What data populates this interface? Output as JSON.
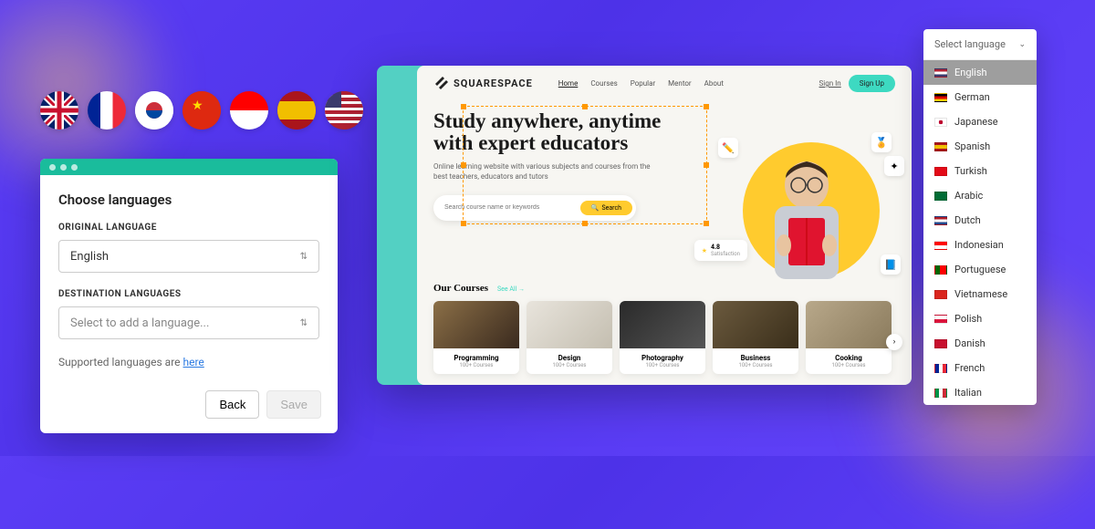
{
  "modal": {
    "title": "Choose languages",
    "original_label": "ORIGINAL LANGUAGE",
    "original_value": "English",
    "destination_label": "DESTINATION LANGUAGES",
    "destination_placeholder": "Select to add a language...",
    "supported_prefix": "Supported languages are ",
    "supported_link": "here",
    "back": "Back",
    "save": "Save"
  },
  "site": {
    "brand": "SQUARESPACE",
    "nav": {
      "home": "Home",
      "courses": "Courses",
      "popular": "Popular",
      "mentor": "Mentor",
      "about": "About"
    },
    "signin": "Sign In",
    "signup": "Sign Up",
    "hero_title": "Study anywhere, anytime with expert educators",
    "hero_sub": "Online learning website with various subjects and courses from the best teachers, educators and tutors",
    "search_placeholder": "Search course name or keywords",
    "search_btn": "Search",
    "rating_score": "4.8",
    "rating_label": "Satisfaction",
    "courses_title": "Our Courses",
    "see_all": "See All",
    "courses": [
      {
        "name": "Programming",
        "count": "100+ Courses"
      },
      {
        "name": "Design",
        "count": "100+ Courses"
      },
      {
        "name": "Photography",
        "count": "100+ Courses"
      },
      {
        "name": "Business",
        "count": "100+ Courses"
      },
      {
        "name": "Cooking",
        "count": "100+ Courses"
      }
    ]
  },
  "dropdown": {
    "placeholder": "Select language",
    "items": [
      {
        "label": "English",
        "flag": "us",
        "selected": true
      },
      {
        "label": "German",
        "flag": "de"
      },
      {
        "label": "Japanese",
        "flag": "jp"
      },
      {
        "label": "Spanish",
        "flag": "es"
      },
      {
        "label": "Turkish",
        "flag": "tr"
      },
      {
        "label": "Arabic",
        "flag": "sa"
      },
      {
        "label": "Dutch",
        "flag": "nl"
      },
      {
        "label": "Indonesian",
        "flag": "id"
      },
      {
        "label": "Portuguese",
        "flag": "pt"
      },
      {
        "label": "Vietnamese",
        "flag": "vn"
      },
      {
        "label": "Polish",
        "flag": "pl"
      },
      {
        "label": "Danish",
        "flag": "dk"
      },
      {
        "label": "French",
        "flag": "fr"
      },
      {
        "label": "Italian",
        "flag": "it"
      }
    ]
  },
  "flag_colors": {
    "us": "linear-gradient(180deg,#b22234 0 33%,#fff 33% 66%,#3c3b6e 66%)",
    "de": "linear-gradient(180deg,#000 0 33%,#dd0000 33% 66%,#ffce00 66%)",
    "jp": "radial-gradient(circle,#bc002d 30%,#fff 32%)",
    "es": "linear-gradient(180deg,#aa151b 0 25%,#f1bf00 25% 75%,#aa151b 75%)",
    "tr": "#e30a17",
    "sa": "#006c35",
    "nl": "linear-gradient(180deg,#ae1c28 0 33%,#fff 33% 66%,#21468b 66%)",
    "id": "linear-gradient(180deg,#ff0000 0 50%,#fff 50%)",
    "pt": "linear-gradient(90deg,#006600 0 40%,#ff0000 40%)",
    "vn": "#da251d",
    "pl": "linear-gradient(180deg,#fff 0 50%,#dc143c 50%)",
    "dk": "#c8102e",
    "fr": "linear-gradient(90deg,#002395 0 33%,#fff 33% 66%,#ed2939 66%)",
    "it": "linear-gradient(90deg,#009246 0 33%,#fff 33% 66%,#ce2b37 66%)",
    "gb": "#012169",
    "kr": "#fff",
    "cn": "#de2910"
  },
  "flags_row": [
    "gb",
    "fr",
    "kr",
    "cn",
    "id",
    "es",
    "us"
  ]
}
